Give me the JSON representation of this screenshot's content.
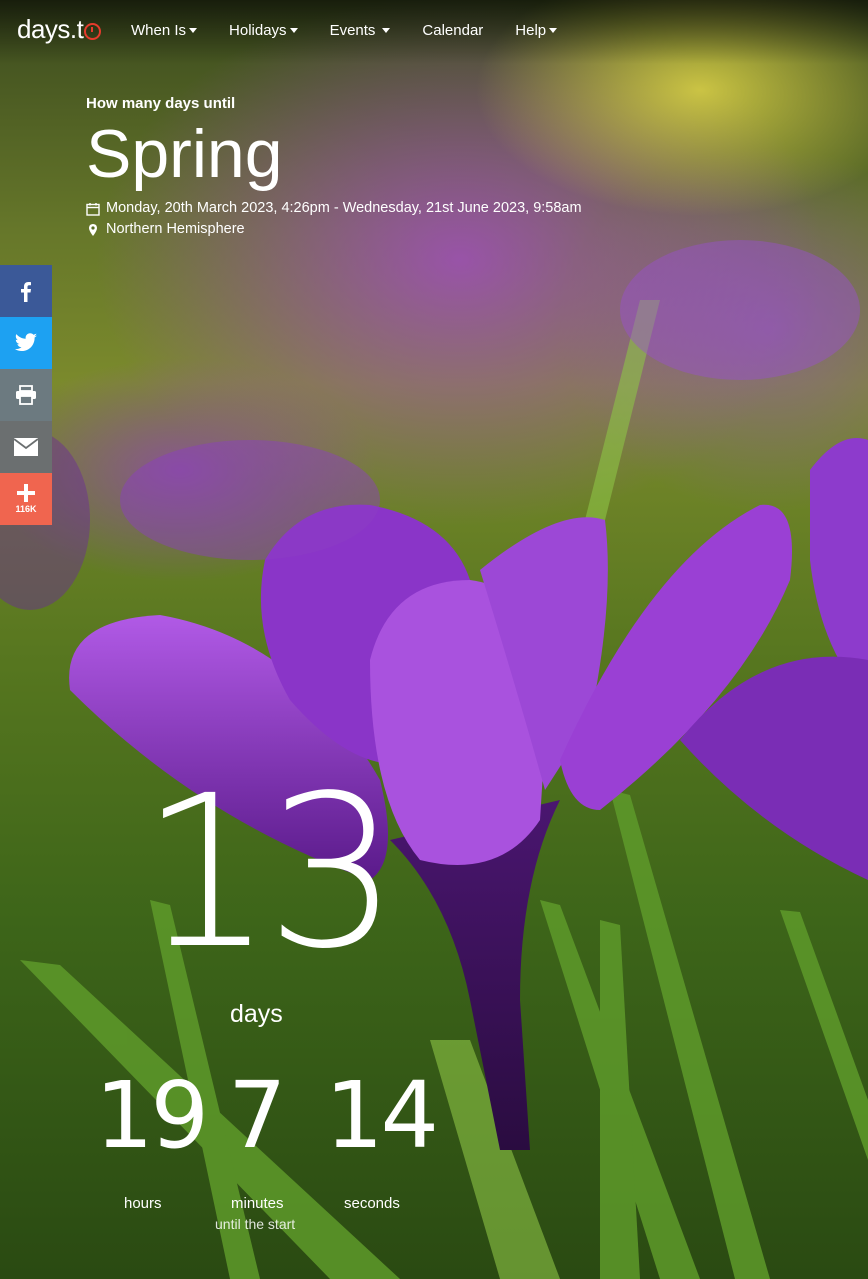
{
  "brand": {
    "logo_text": "days.t",
    "accent": "#e53b2c"
  },
  "nav": [
    {
      "label": "When Is",
      "dropdown": true
    },
    {
      "label": "Holidays",
      "dropdown": true
    },
    {
      "label": "Events",
      "dropdown": true
    },
    {
      "label": "Calendar",
      "dropdown": false
    },
    {
      "label": "Help",
      "dropdown": true
    }
  ],
  "hero": {
    "pretitle": "How many days until",
    "title": "Spring",
    "date_range": "Monday, 20th March 2023, 4:26pm - Wednesday, 21st June 2023, 9:58am",
    "location": "Northern Hemisphere"
  },
  "share": {
    "buttons": [
      {
        "name": "facebook",
        "color": "#3b5998"
      },
      {
        "name": "twitter",
        "color": "#1da1f2"
      },
      {
        "name": "print",
        "color": "#6c7a80"
      },
      {
        "name": "email",
        "color": "#6b6f70"
      },
      {
        "name": "more",
        "color": "#f0654f"
      }
    ],
    "count": "116K"
  },
  "countdown": {
    "days": "13",
    "days_label": "days",
    "hours": "19",
    "minutes": "7",
    "seconds": "14",
    "hours_label": "hours",
    "minutes_label": "minutes",
    "seconds_label": "seconds",
    "caption": "until the start"
  }
}
